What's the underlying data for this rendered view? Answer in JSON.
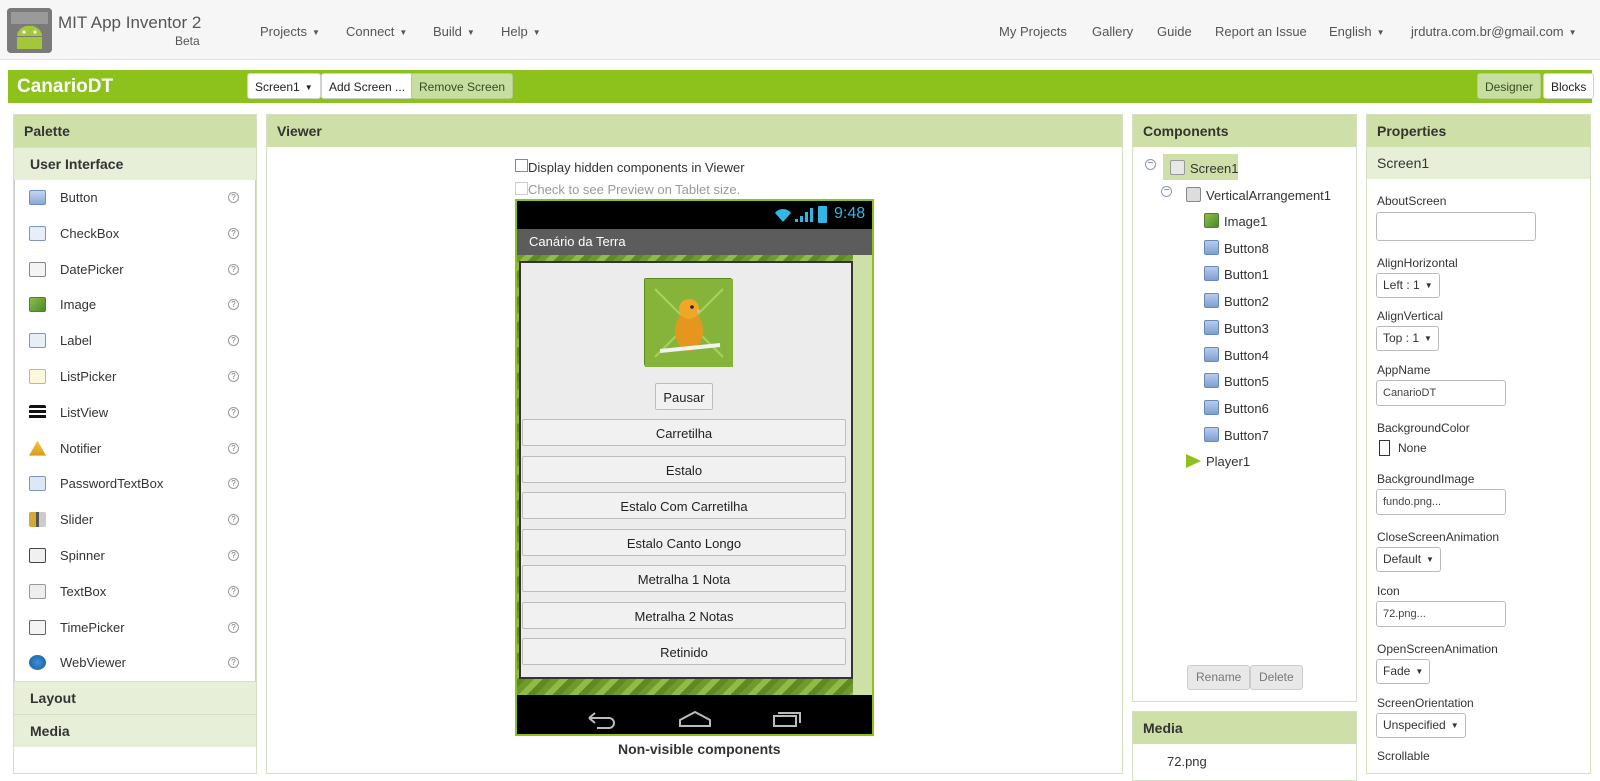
{
  "topbar": {
    "title": "MIT App Inventor 2",
    "beta": "Beta",
    "menus": [
      "Projects",
      "Connect",
      "Build",
      "Help"
    ],
    "right_links": [
      "My Projects",
      "Gallery",
      "Guide",
      "Report an Issue"
    ],
    "language": "English",
    "account": "jrdutra.com.br@gmail.com"
  },
  "project": {
    "name": "CanarioDT",
    "screen_select": "Screen1",
    "add_screen": "Add Screen ...",
    "remove_screen": "Remove Screen",
    "designer": "Designer",
    "blocks": "Blocks"
  },
  "palette": {
    "title": "Palette",
    "category": "User Interface",
    "items": [
      {
        "label": "Button",
        "icon": "button-icon"
      },
      {
        "label": "CheckBox",
        "icon": "checkbox-icon"
      },
      {
        "label": "DatePicker",
        "icon": "datepicker-icon"
      },
      {
        "label": "Image",
        "icon": "image-icon"
      },
      {
        "label": "Label",
        "icon": "label-icon"
      },
      {
        "label": "ListPicker",
        "icon": "listpicker-icon"
      },
      {
        "label": "ListView",
        "icon": "listview-icon"
      },
      {
        "label": "Notifier",
        "icon": "notifier-icon"
      },
      {
        "label": "PasswordTextBox",
        "icon": "passwordtextbox-icon"
      },
      {
        "label": "Slider",
        "icon": "slider-icon"
      },
      {
        "label": "Spinner",
        "icon": "spinner-icon"
      },
      {
        "label": "TextBox",
        "icon": "textbox-icon"
      },
      {
        "label": "TimePicker",
        "icon": "timepicker-icon"
      },
      {
        "label": "WebViewer",
        "icon": "webviewer-icon"
      }
    ],
    "help_glyph": "?",
    "more_categories": [
      "Layout",
      "Media"
    ]
  },
  "viewer": {
    "title": "Viewer",
    "display_hidden": "Display hidden components in Viewer",
    "tablet_preview": "Check to see Preview on Tablet size.",
    "phone": {
      "time": "9:48",
      "screen_title": "Canário da Terra",
      "buttons": [
        "Pausar",
        "Carretilha",
        "Estalo",
        "Estalo Com Carretilha",
        "Estalo Canto Longo",
        "Metralha 1 Nota",
        "Metralha 2 Notas",
        "Retinido"
      ]
    },
    "non_visible": "Non-visible components"
  },
  "components": {
    "title": "Components",
    "screen": "Screen1",
    "arrangement": "VerticalArrangement1",
    "children": [
      "Image1",
      "Button8",
      "Button1",
      "Button2",
      "Button3",
      "Button4",
      "Button5",
      "Button6",
      "Button7"
    ],
    "player": "Player1",
    "rename": "Rename",
    "delete": "Delete"
  },
  "media": {
    "title": "Media",
    "files": [
      "72.png"
    ]
  },
  "properties": {
    "title": "Properties",
    "component": "Screen1",
    "about_label": "AboutScreen",
    "about_value": "",
    "align_h_label": "AlignHorizontal",
    "align_h_value": "Left : 1",
    "align_v_label": "AlignVertical",
    "align_v_value": "Top : 1",
    "appname_label": "AppName",
    "appname_value": "CanarioDT",
    "bgcolor_label": "BackgroundColor",
    "bgcolor_value": "None",
    "bgimage_label": "BackgroundImage",
    "bgimage_value": "fundo.png...",
    "close_anim_label": "CloseScreenAnimation",
    "close_anim_value": "Default",
    "icon_label": "Icon",
    "icon_value": "72.png...",
    "open_anim_label": "OpenScreenAnimation",
    "open_anim_value": "Fade",
    "orientation_label": "ScreenOrientation",
    "orientation_value": "Unspecified",
    "scrollable_label": "Scrollable"
  },
  "colors": {
    "brand_green": "#8dc11c",
    "panel_header": "#cfdfa8"
  }
}
